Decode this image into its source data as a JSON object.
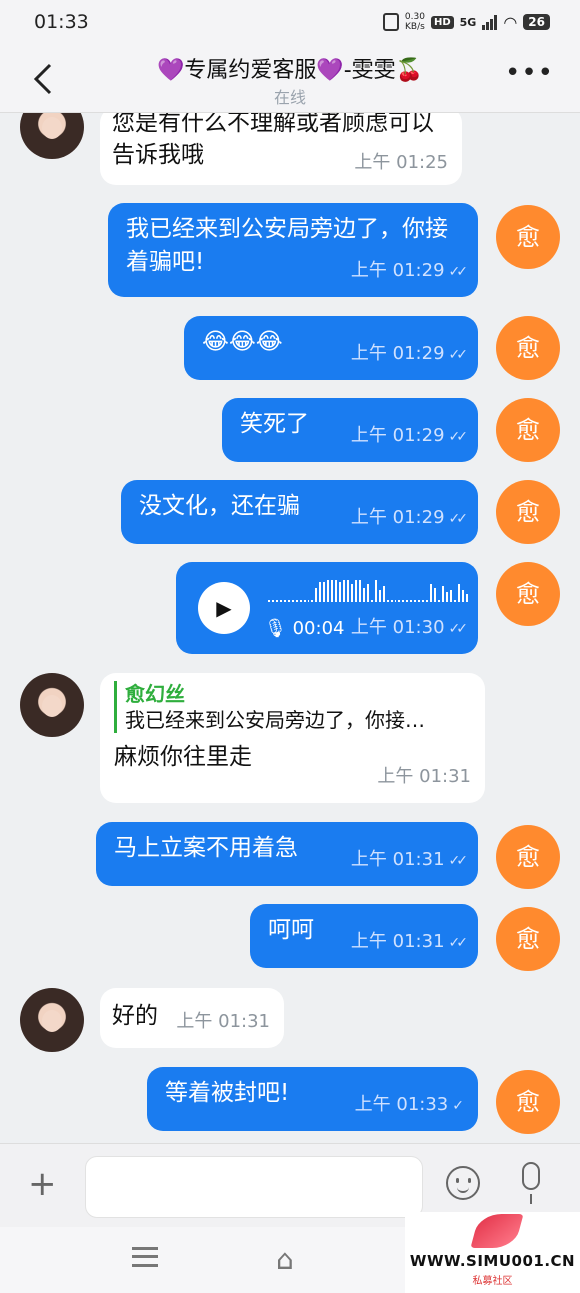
{
  "status_bar": {
    "time": "01:33",
    "net_speed_top": "0.30",
    "net_speed_unit": "KB/s",
    "hd": "HD",
    "network": "5G",
    "battery": "26"
  },
  "header": {
    "title": "💜专属约爱客服💜-雯雯🍒",
    "subtitle": "在线"
  },
  "messages": [
    {
      "text": "您是有什么不理解或者顾虑可以告诉我哦",
      "time": "上午  01:25"
    },
    {
      "text": "我已经来到公安局旁边了，你接着骗吧!",
      "time": "上午  01:29"
    },
    {
      "text": "😂😂😂",
      "time": "上午  01:29"
    },
    {
      "text": "笑死了",
      "time": "上午  01:29"
    },
    {
      "text": "没文化，还在骗",
      "time": "上午  01:29"
    },
    {
      "duration": "00:04",
      "time": "上午  01:30"
    },
    {
      "quote_name": "愈幻丝",
      "quote_text": "我已经来到公安局旁边了，你接…",
      "text": "麻烦你往里走",
      "time": "上午  01:31"
    },
    {
      "text": "马上立案不用着急",
      "time": "上午  01:31"
    },
    {
      "text": "呵呵",
      "time": "上午  01:31"
    },
    {
      "text": "好的",
      "time": "上午  01:31"
    },
    {
      "text": "等着被封吧!",
      "time": "上午  01:33"
    }
  ],
  "my_avatar_char": "愈",
  "watermark": {
    "site": "WWW.SIMU001.CN",
    "sub": "私募社区"
  }
}
